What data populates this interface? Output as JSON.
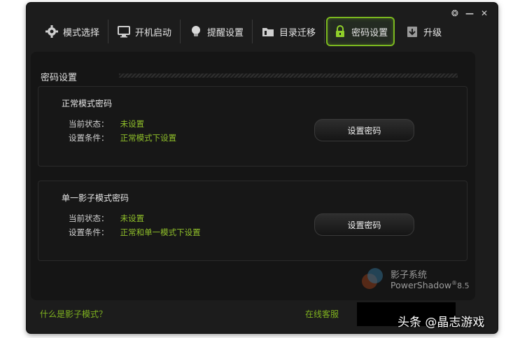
{
  "title_buttons": [
    "❂",
    "—",
    "✕"
  ],
  "tabs": [
    {
      "label": "模式选择",
      "icon": "gear-icon"
    },
    {
      "label": "开机启动",
      "icon": "monitor-icon"
    },
    {
      "label": "提醒设置",
      "icon": "bulb-icon"
    },
    {
      "label": "目录迁移",
      "icon": "folder-icon"
    },
    {
      "label": "密码设置",
      "icon": "lock-icon",
      "active": true
    },
    {
      "label": "升级",
      "icon": "upgrade-icon"
    }
  ],
  "panel": {
    "title": "密码设置",
    "normal": {
      "title": "正常模式密码",
      "status_label": "当前状态：",
      "status_value": "未设置",
      "cond_label": "设置条件：",
      "cond_value": "正常模式下设置",
      "button": "设置密码"
    },
    "single": {
      "title": "单一影子模式密码",
      "status_label": "当前状态：",
      "status_value": "未设置",
      "cond_label": "设置条件：",
      "cond_value": "正常和单一模式下设置",
      "button": "设置密码"
    }
  },
  "logo": {
    "name": "影子系统",
    "product": "PowerShadow",
    "version": "8.5"
  },
  "footer": {
    "what_is": "什么是影子模式？",
    "online_service": "在线客服"
  },
  "watermark": "头条 @晶志游戏",
  "colors": {
    "accent": "#7bb81f",
    "value_text": "#8fbf2a"
  }
}
